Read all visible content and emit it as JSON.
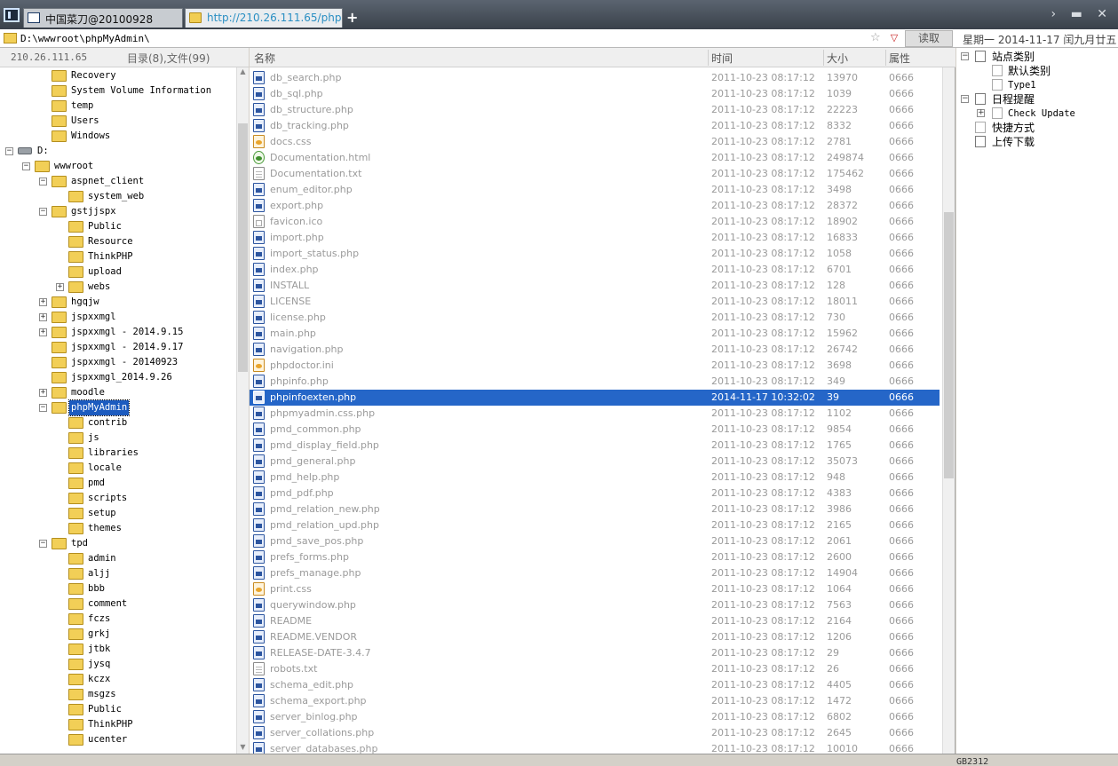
{
  "tabs": [
    {
      "label": "中国菜刀@20100928"
    },
    {
      "label": "http://210.26.111.65/phpMy..."
    }
  ],
  "new_tab_label": "+",
  "tab_controls": "› ▬ ✕",
  "address": {
    "path": "D:\\wwwroot\\phpMyAdmin\\",
    "star": "☆",
    "dropdown": "▽",
    "read_button": "读取",
    "date": "星期一 2014-11-17 闰九月廿五"
  },
  "left": {
    "host": "210.26.111.65",
    "counts": "目录(8),文件(99)",
    "tree": [
      {
        "label": "Recovery",
        "level": 2,
        "type": "folder",
        "exp": ""
      },
      {
        "label": "System Volume Information",
        "level": 2,
        "type": "folder",
        "exp": ""
      },
      {
        "label": "temp",
        "level": 2,
        "type": "folder",
        "exp": ""
      },
      {
        "label": "Users",
        "level": 2,
        "type": "folder",
        "exp": ""
      },
      {
        "label": "Windows",
        "level": 2,
        "type": "folder",
        "exp": ""
      },
      {
        "label": "D:",
        "level": 0,
        "type": "drive",
        "exp": "−"
      },
      {
        "label": "wwwroot",
        "level": 1,
        "type": "folder",
        "exp": "−"
      },
      {
        "label": "aspnet_client",
        "level": 2,
        "type": "folder",
        "exp": "−"
      },
      {
        "label": "system_web",
        "level": 3,
        "type": "folder",
        "exp": ""
      },
      {
        "label": "gstjjspx",
        "level": 2,
        "type": "folder",
        "exp": "−"
      },
      {
        "label": "Public",
        "level": 3,
        "type": "folder",
        "exp": ""
      },
      {
        "label": "Resource",
        "level": 3,
        "type": "folder",
        "exp": ""
      },
      {
        "label": "ThinkPHP",
        "level": 3,
        "type": "folder",
        "exp": ""
      },
      {
        "label": "upload",
        "level": 3,
        "type": "folder",
        "exp": ""
      },
      {
        "label": "webs",
        "level": 3,
        "type": "folder",
        "exp": "+"
      },
      {
        "label": "hgqjw",
        "level": 2,
        "type": "folder",
        "exp": "+"
      },
      {
        "label": "jspxxmgl",
        "level": 2,
        "type": "folder",
        "exp": "+"
      },
      {
        "label": "jspxxmgl - 2014.9.15",
        "level": 2,
        "type": "folder",
        "exp": "+"
      },
      {
        "label": "jspxxmgl - 2014.9.17",
        "level": 2,
        "type": "folder",
        "exp": ""
      },
      {
        "label": "jspxxmgl - 20140923",
        "level": 2,
        "type": "folder",
        "exp": ""
      },
      {
        "label": "jspxxmgl_2014.9.26",
        "level": 2,
        "type": "folder",
        "exp": ""
      },
      {
        "label": "moodle",
        "level": 2,
        "type": "folder",
        "exp": "+"
      },
      {
        "label": "phpMyAdmin",
        "level": 2,
        "type": "folder",
        "exp": "−",
        "selected": true
      },
      {
        "label": "contrib",
        "level": 3,
        "type": "folder",
        "exp": ""
      },
      {
        "label": "js",
        "level": 3,
        "type": "folder",
        "exp": ""
      },
      {
        "label": "libraries",
        "level": 3,
        "type": "folder",
        "exp": ""
      },
      {
        "label": "locale",
        "level": 3,
        "type": "folder",
        "exp": ""
      },
      {
        "label": "pmd",
        "level": 3,
        "type": "folder",
        "exp": ""
      },
      {
        "label": "scripts",
        "level": 3,
        "type": "folder",
        "exp": ""
      },
      {
        "label": "setup",
        "level": 3,
        "type": "folder",
        "exp": ""
      },
      {
        "label": "themes",
        "level": 3,
        "type": "folder",
        "exp": ""
      },
      {
        "label": "tpd",
        "level": 2,
        "type": "folder",
        "exp": "−"
      },
      {
        "label": "admin",
        "level": 3,
        "type": "folder",
        "exp": ""
      },
      {
        "label": "aljj",
        "level": 3,
        "type": "folder",
        "exp": ""
      },
      {
        "label": "bbb",
        "level": 3,
        "type": "folder",
        "exp": ""
      },
      {
        "label": "comment",
        "level": 3,
        "type": "folder",
        "exp": ""
      },
      {
        "label": "fczs",
        "level": 3,
        "type": "folder",
        "exp": ""
      },
      {
        "label": "grkj",
        "level": 3,
        "type": "folder",
        "exp": ""
      },
      {
        "label": "jtbk",
        "level": 3,
        "type": "folder",
        "exp": ""
      },
      {
        "label": "jysq",
        "level": 3,
        "type": "folder",
        "exp": ""
      },
      {
        "label": "kczx",
        "level": 3,
        "type": "folder",
        "exp": ""
      },
      {
        "label": "msgzs",
        "level": 3,
        "type": "folder",
        "exp": ""
      },
      {
        "label": "Public",
        "level": 3,
        "type": "folder",
        "exp": ""
      },
      {
        "label": "ThinkPHP",
        "level": 3,
        "type": "folder",
        "exp": ""
      },
      {
        "label": "ucenter",
        "level": 3,
        "type": "folder",
        "exp": ""
      }
    ]
  },
  "files": {
    "columns": {
      "name": "名称",
      "time": "时间",
      "size": "大小",
      "attr": "属性"
    },
    "rows": [
      {
        "name": "db_search.php",
        "time": "2011-10-23 08:17:12",
        "size": "13970",
        "attr": "0666",
        "icon": "php"
      },
      {
        "name": "db_sql.php",
        "time": "2011-10-23 08:17:12",
        "size": "1039",
        "attr": "0666",
        "icon": "php"
      },
      {
        "name": "db_structure.php",
        "time": "2011-10-23 08:17:12",
        "size": "22223",
        "attr": "0666",
        "icon": "php"
      },
      {
        "name": "db_tracking.php",
        "time": "2011-10-23 08:17:12",
        "size": "8332",
        "attr": "0666",
        "icon": "php"
      },
      {
        "name": "docs.css",
        "time": "2011-10-23 08:17:12",
        "size": "2781",
        "attr": "0666",
        "icon": "css"
      },
      {
        "name": "Documentation.html",
        "time": "2011-10-23 08:17:12",
        "size": "249874",
        "attr": "0666",
        "icon": "html"
      },
      {
        "name": "Documentation.txt",
        "time": "2011-10-23 08:17:12",
        "size": "175462",
        "attr": "0666",
        "icon": "txt"
      },
      {
        "name": "enum_editor.php",
        "time": "2011-10-23 08:17:12",
        "size": "3498",
        "attr": "0666",
        "icon": "php"
      },
      {
        "name": "export.php",
        "time": "2011-10-23 08:17:12",
        "size": "28372",
        "attr": "0666",
        "icon": "php"
      },
      {
        "name": "favicon.ico",
        "time": "2011-10-23 08:17:12",
        "size": "18902",
        "attr": "0666",
        "icon": "ico"
      },
      {
        "name": "import.php",
        "time": "2011-10-23 08:17:12",
        "size": "16833",
        "attr": "0666",
        "icon": "php"
      },
      {
        "name": "import_status.php",
        "time": "2011-10-23 08:17:12",
        "size": "1058",
        "attr": "0666",
        "icon": "php"
      },
      {
        "name": "index.php",
        "time": "2011-10-23 08:17:12",
        "size": "6701",
        "attr": "0666",
        "icon": "php"
      },
      {
        "name": "INSTALL",
        "time": "2011-10-23 08:17:12",
        "size": "128",
        "attr": "0666",
        "icon": "php"
      },
      {
        "name": "LICENSE",
        "time": "2011-10-23 08:17:12",
        "size": "18011",
        "attr": "0666",
        "icon": "php"
      },
      {
        "name": "license.php",
        "time": "2011-10-23 08:17:12",
        "size": "730",
        "attr": "0666",
        "icon": "php"
      },
      {
        "name": "main.php",
        "time": "2011-10-23 08:17:12",
        "size": "15962",
        "attr": "0666",
        "icon": "php"
      },
      {
        "name": "navigation.php",
        "time": "2011-10-23 08:17:12",
        "size": "26742",
        "attr": "0666",
        "icon": "php"
      },
      {
        "name": "phpdoctor.ini",
        "time": "2011-10-23 08:17:12",
        "size": "3698",
        "attr": "0666",
        "icon": "css"
      },
      {
        "name": "phpinfo.php",
        "time": "2011-10-23 08:17:12",
        "size": "349",
        "attr": "0666",
        "icon": "php"
      },
      {
        "name": "phpinfoexten.php",
        "time": "2014-11-17 10:32:02",
        "size": "39",
        "attr": "0666",
        "icon": "php",
        "selected": true
      },
      {
        "name": "phpmyadmin.css.php",
        "time": "2011-10-23 08:17:12",
        "size": "1102",
        "attr": "0666",
        "icon": "php"
      },
      {
        "name": "pmd_common.php",
        "time": "2011-10-23 08:17:12",
        "size": "9854",
        "attr": "0666",
        "icon": "php"
      },
      {
        "name": "pmd_display_field.php",
        "time": "2011-10-23 08:17:12",
        "size": "1765",
        "attr": "0666",
        "icon": "php"
      },
      {
        "name": "pmd_general.php",
        "time": "2011-10-23 08:17:12",
        "size": "35073",
        "attr": "0666",
        "icon": "php"
      },
      {
        "name": "pmd_help.php",
        "time": "2011-10-23 08:17:12",
        "size": "948",
        "attr": "0666",
        "icon": "php"
      },
      {
        "name": "pmd_pdf.php",
        "time": "2011-10-23 08:17:12",
        "size": "4383",
        "attr": "0666",
        "icon": "php"
      },
      {
        "name": "pmd_relation_new.php",
        "time": "2011-10-23 08:17:12",
        "size": "3986",
        "attr": "0666",
        "icon": "php"
      },
      {
        "name": "pmd_relation_upd.php",
        "time": "2011-10-23 08:17:12",
        "size": "2165",
        "attr": "0666",
        "icon": "php"
      },
      {
        "name": "pmd_save_pos.php",
        "time": "2011-10-23 08:17:12",
        "size": "2061",
        "attr": "0666",
        "icon": "php"
      },
      {
        "name": "prefs_forms.php",
        "time": "2011-10-23 08:17:12",
        "size": "2600",
        "attr": "0666",
        "icon": "php"
      },
      {
        "name": "prefs_manage.php",
        "time": "2011-10-23 08:17:12",
        "size": "14904",
        "attr": "0666",
        "icon": "php"
      },
      {
        "name": "print.css",
        "time": "2011-10-23 08:17:12",
        "size": "1064",
        "attr": "0666",
        "icon": "css"
      },
      {
        "name": "querywindow.php",
        "time": "2011-10-23 08:17:12",
        "size": "7563",
        "attr": "0666",
        "icon": "php"
      },
      {
        "name": "README",
        "time": "2011-10-23 08:17:12",
        "size": "2164",
        "attr": "0666",
        "icon": "php"
      },
      {
        "name": "README.VENDOR",
        "time": "2011-10-23 08:17:12",
        "size": "1206",
        "attr": "0666",
        "icon": "php"
      },
      {
        "name": "RELEASE-DATE-3.4.7",
        "time": "2011-10-23 08:17:12",
        "size": "29",
        "attr": "0666",
        "icon": "php"
      },
      {
        "name": "robots.txt",
        "time": "2011-10-23 08:17:12",
        "size": "26",
        "attr": "0666",
        "icon": "txt"
      },
      {
        "name": "schema_edit.php",
        "time": "2011-10-23 08:17:12",
        "size": "4405",
        "attr": "0666",
        "icon": "php"
      },
      {
        "name": "schema_export.php",
        "time": "2011-10-23 08:17:12",
        "size": "1472",
        "attr": "0666",
        "icon": "php"
      },
      {
        "name": "server_binlog.php",
        "time": "2011-10-23 08:17:12",
        "size": "6802",
        "attr": "0666",
        "icon": "php"
      },
      {
        "name": "server_collations.php",
        "time": "2011-10-23 08:17:12",
        "size": "2645",
        "attr": "0666",
        "icon": "php"
      },
      {
        "name": "server_databases.php",
        "time": "2011-10-23 08:17:12",
        "size": "10010",
        "attr": "0666",
        "icon": "php"
      }
    ]
  },
  "right": {
    "items": [
      {
        "label": "站点类别",
        "level": 0,
        "exp": "−",
        "icon": "box"
      },
      {
        "label": "默认类别",
        "level": 1,
        "exp": "",
        "icon": "doc"
      },
      {
        "label": "Type1",
        "level": 1,
        "exp": "",
        "icon": "doc",
        "mono": true
      },
      {
        "label": "日程提醒",
        "level": 0,
        "exp": "−",
        "icon": "clock"
      },
      {
        "label": "Check Update",
        "level": 1,
        "exp": "+",
        "icon": "doc",
        "mono": true
      },
      {
        "label": "快捷方式",
        "level": 0,
        "exp": "",
        "icon": "doc"
      },
      {
        "label": "上传下载",
        "level": 0,
        "exp": "",
        "icon": "box"
      }
    ]
  },
  "status": {
    "encoding": "GB2312"
  },
  "colors": {
    "selection": "#2566c8",
    "tree_selection": "#1c5bbf",
    "folder": "#f2cf57"
  }
}
